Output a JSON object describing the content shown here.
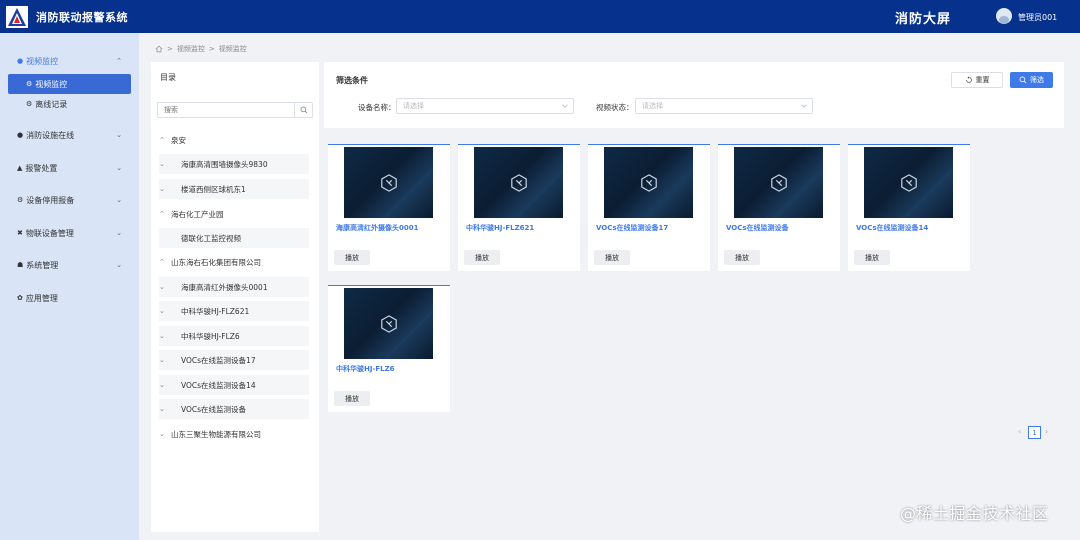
{
  "header": {
    "app_title": "消防联动报警系统",
    "big_screen": "消防大屏",
    "user_name": "管理员001"
  },
  "sidebar": {
    "items": [
      {
        "label": "视频监控",
        "icon": "video-icon",
        "expanded": true,
        "active": true,
        "children": [
          {
            "label": "视频监控",
            "active": true
          },
          {
            "label": "离线记录",
            "active": false
          }
        ]
      },
      {
        "label": "消防设施在线",
        "icon": "bulb-icon"
      },
      {
        "label": "报警处置",
        "icon": "alarm-icon"
      },
      {
        "label": "设备停用报备",
        "icon": "gear-icon"
      },
      {
        "label": "物联设备管理",
        "icon": "tools-icon"
      },
      {
        "label": "系统管理",
        "icon": "system-icon"
      },
      {
        "label": "应用管理",
        "icon": "app-icon"
      }
    ]
  },
  "breadcrumb": {
    "items": [
      "视频监控",
      "视频监控"
    ]
  },
  "tree": {
    "title": "目录",
    "search_placeholder": "搜索",
    "nodes": [
      {
        "label": "泉安",
        "level": 0,
        "expanded": true
      },
      {
        "label": "海康高清围墙摄像头9830",
        "level": 1,
        "has_children": true
      },
      {
        "label": "楼道西侧区球机东1",
        "level": 1,
        "has_children": true
      },
      {
        "label": "海右化工产业园",
        "level": 0,
        "expanded": true
      },
      {
        "label": "德联化工监控视频",
        "level": 1,
        "has_children": false
      },
      {
        "label": "山东海右石化集团有限公司",
        "level": 0,
        "expanded": true
      },
      {
        "label": "海康高清红外摄像头0001",
        "level": 1,
        "has_children": true
      },
      {
        "label": "中科华骏HJ-FLZ621",
        "level": 1,
        "has_children": true
      },
      {
        "label": "中科华骏HJ-FLZ6",
        "level": 1,
        "has_children": true
      },
      {
        "label": "VOCs在线监测设备17",
        "level": 1,
        "has_children": true
      },
      {
        "label": "VOCs在线监测设备14",
        "level": 1,
        "has_children": true
      },
      {
        "label": "VOCs在线监测设备",
        "level": 1,
        "has_children": true
      },
      {
        "label": "山东三聚生物能源有限公司",
        "level": 0,
        "expanded": false
      }
    ]
  },
  "filter": {
    "title": "筛选条件",
    "reset_label": "重置",
    "filter_label": "筛选",
    "device_name_label": "设备名称：",
    "device_name_placeholder": "请选择",
    "video_status_label": "视频状态：",
    "video_status_placeholder": "请选择"
  },
  "cards": [
    {
      "name": "海康高清红外摄像头0001",
      "play_label": "播放"
    },
    {
      "name": "中科华骏HJ-FLZ621",
      "play_label": "播放"
    },
    {
      "name": "VOCs在线监测设备17",
      "play_label": "播放"
    },
    {
      "name": "VOCs在线监测设备",
      "play_label": "播放"
    },
    {
      "name": "VOCs在线监测设备14",
      "play_label": "播放"
    },
    {
      "name": "中科华骏HJ-FLZ6",
      "play_label": "播放"
    }
  ],
  "pagination": {
    "current": "1",
    "prev": "‹",
    "next": "›"
  },
  "watermark": "@稀土掘金技术社区",
  "colors": {
    "header_bg": "#06318c",
    "sidebar_bg": "#d9e4f6",
    "accent": "#3f7ae8",
    "active_menu": "#3869d4"
  }
}
